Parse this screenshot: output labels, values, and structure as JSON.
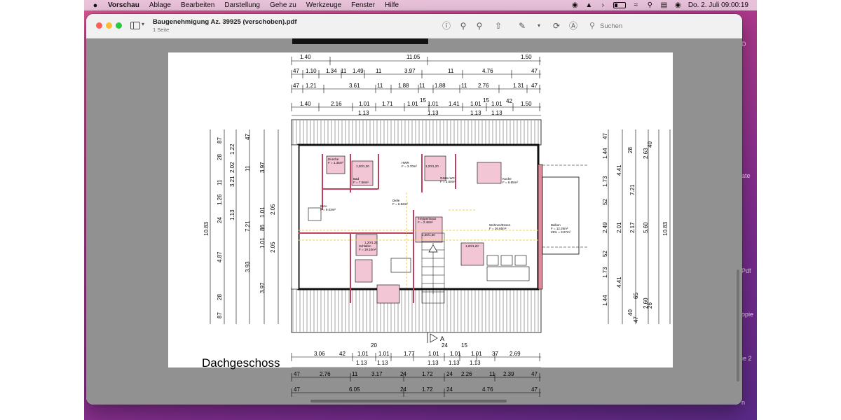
{
  "menubar": {
    "items": [
      "Vorschau",
      "Ablage",
      "Bearbeiten",
      "Darstellung",
      "Gehe zu",
      "Werkzeuge",
      "Fenster",
      "Hilfe"
    ],
    "datetime": "Do. 2. Juli  09:00:19"
  },
  "window": {
    "doc_title": "Baugenehmigung Az. 39925 (verschoben).pdf",
    "doc_subtitle": "1 Seite",
    "search_placeholder": "Suchen"
  },
  "plan": {
    "title": "Dachgeschoss",
    "top_dims_row1": [
      "1.40",
      "11.05",
      "1.50"
    ],
    "top_dims_row2": [
      "47",
      "1.10",
      "1.34",
      "11",
      "1.49",
      "11",
      "3.97",
      "11",
      "4.76",
      "47"
    ],
    "top_dims_row3": [
      "47",
      "1.21",
      "3.61",
      "11",
      "1.88",
      "11",
      "1.88",
      "11",
      "2.76",
      "1.31",
      "47"
    ],
    "top_dims_row4": [
      "1.40",
      "2.16",
      "1.01",
      "1.71",
      "1.01",
      "15",
      "1.01",
      "1.41",
      "1.01",
      "15",
      "1.01",
      "42",
      "1.50"
    ],
    "top_dims_row5": [
      "1.13",
      "1.13",
      "1.13",
      "1.13"
    ],
    "left_dims": [
      "87",
      "28",
      "11",
      "1.26",
      "24",
      "1.13",
      "4.87",
      "28",
      "87",
      "1.22",
      "2.02",
      "3.21",
      "1.01",
      "86",
      "1.01",
      "11",
      "47",
      "3.97",
      "2.05",
      "7.21",
      "2.05",
      "3.93",
      "3.97",
      "10.83"
    ],
    "right_dims": [
      "47",
      "1.44",
      "28",
      "40",
      "2.63",
      "4.41",
      "1.73",
      "52",
      "2.49",
      "2.01",
      "2.17",
      "5.60",
      "7.21",
      "10.83",
      "52",
      "1.73",
      "4.41",
      "1.44",
      "65",
      "2.60",
      "40",
      "47",
      "26"
    ],
    "bottom_dims_row1": [
      "3.06",
      "42",
      "1.01",
      "1.01",
      "1.77",
      "1.01",
      "1.01",
      "1.01",
      "37",
      "2.69"
    ],
    "bottom_dims_row1b": [
      "20",
      "24",
      "15"
    ],
    "bottom_dims_row2": [
      "1.13",
      "1.13",
      "1.13",
      "1.13",
      "1.13"
    ],
    "bottom_dims_row3": [
      "47",
      "2.76",
      "11",
      "3.17",
      "24",
      "1.72",
      "24",
      "2.26",
      "11",
      "2.39",
      "47"
    ],
    "bottom_dims_row4": [
      "47",
      "6.05",
      "24",
      "1.72",
      "24",
      "4.76",
      "47"
    ],
    "rooms": [
      {
        "name": "Dusche",
        "area": "F = 1.35m²"
      },
      {
        "name": "Bad",
        "area": "F = 7.56m²"
      },
      {
        "name": "HWR",
        "area": "F = 3.70m²"
      },
      {
        "name": "Gäste-WC",
        "area": "F = 3.50m²"
      },
      {
        "name": "Küche",
        "area": "F = 6.85m²"
      },
      {
        "name": "Diele",
        "area": "F = 6.82m²"
      },
      {
        "name": "Büro",
        "area": "F = 9.03m²"
      },
      {
        "name": "Treppenhaus",
        "area": "F = 2.48m²"
      },
      {
        "name": "Wohnen/Essen",
        "area": "F = 26.65m²"
      },
      {
        "name": "Schlafen",
        "area": "F = 19.10m²"
      },
      {
        "name": "Balkon",
        "area": "F = 12.26m²"
      }
    ],
    "balcony_note": "25% = 3.07m²",
    "window_labels": [
      "1,20/1,20",
      "1,20/1,20",
      "1,50/1,50",
      "1,20/1,20",
      "1,20/1,20"
    ],
    "section_mark": "A"
  },
  "background_labels": [
    "D",
    "ate",
    "Pdf",
    "opie",
    "ie 2",
    "n"
  ]
}
